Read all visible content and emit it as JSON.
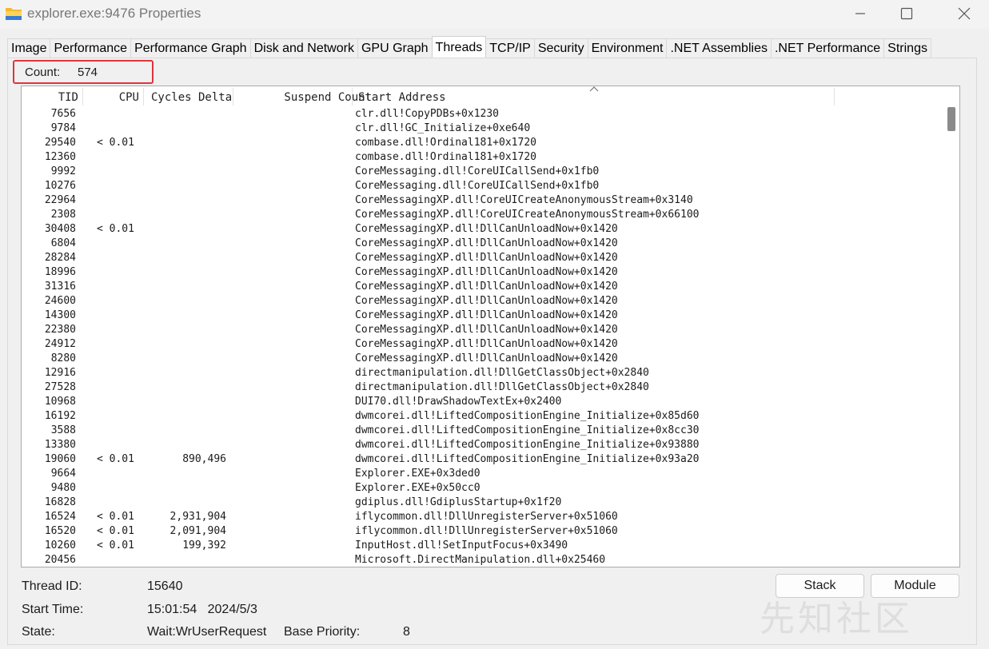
{
  "window": {
    "title": "explorer.exe:9476 Properties",
    "controls": {
      "minimize": "minimize-icon",
      "maximize": "maximize-icon",
      "close": "close-icon"
    }
  },
  "tabs": [
    {
      "label": "Image",
      "active": false
    },
    {
      "label": "Performance",
      "active": false
    },
    {
      "label": "Performance Graph",
      "active": false
    },
    {
      "label": "Disk and Network",
      "active": false
    },
    {
      "label": "GPU Graph",
      "active": false
    },
    {
      "label": "Threads",
      "active": true
    },
    {
      "label": "TCP/IP",
      "active": false
    },
    {
      "label": "Security",
      "active": false
    },
    {
      "label": "Environment",
      "active": false
    },
    {
      "label": ".NET Assemblies",
      "active": false
    },
    {
      "label": ".NET Performance",
      "active": false
    },
    {
      "label": "Strings",
      "active": false
    }
  ],
  "count": {
    "label": "Count:",
    "value": "574"
  },
  "columns": {
    "tid": "TID",
    "cpu": "CPU",
    "cycles": "Cycles Delta",
    "suspend": "Suspend Count",
    "address": "Start Address",
    "sorted_by": "Start Address",
    "sort_direction": "ascending"
  },
  "threads": [
    {
      "tid": "7656",
      "cpu": "",
      "cycles": "",
      "suspend": "",
      "address": "clr.dll!CopyPDBs+0x1230"
    },
    {
      "tid": "9784",
      "cpu": "",
      "cycles": "",
      "suspend": "",
      "address": "clr.dll!GC_Initialize+0xe640"
    },
    {
      "tid": "29540",
      "cpu": "< 0.01",
      "cycles": "",
      "suspend": "",
      "address": "combase.dll!Ordinal181+0x1720"
    },
    {
      "tid": "12360",
      "cpu": "",
      "cycles": "",
      "suspend": "",
      "address": "combase.dll!Ordinal181+0x1720"
    },
    {
      "tid": "9992",
      "cpu": "",
      "cycles": "",
      "suspend": "",
      "address": "CoreMessaging.dll!CoreUICallSend+0x1fb0"
    },
    {
      "tid": "10276",
      "cpu": "",
      "cycles": "",
      "suspend": "",
      "address": "CoreMessaging.dll!CoreUICallSend+0x1fb0"
    },
    {
      "tid": "22964",
      "cpu": "",
      "cycles": "",
      "suspend": "",
      "address": "CoreMessagingXP.dll!CoreUICreateAnonymousStream+0x3140"
    },
    {
      "tid": "2308",
      "cpu": "",
      "cycles": "",
      "suspend": "",
      "address": "CoreMessagingXP.dll!CoreUICreateAnonymousStream+0x66100"
    },
    {
      "tid": "30408",
      "cpu": "< 0.01",
      "cycles": "",
      "suspend": "",
      "address": "CoreMessagingXP.dll!DllCanUnloadNow+0x1420"
    },
    {
      "tid": "6804",
      "cpu": "",
      "cycles": "",
      "suspend": "",
      "address": "CoreMessagingXP.dll!DllCanUnloadNow+0x1420"
    },
    {
      "tid": "28284",
      "cpu": "",
      "cycles": "",
      "suspend": "",
      "address": "CoreMessagingXP.dll!DllCanUnloadNow+0x1420"
    },
    {
      "tid": "18996",
      "cpu": "",
      "cycles": "",
      "suspend": "",
      "address": "CoreMessagingXP.dll!DllCanUnloadNow+0x1420"
    },
    {
      "tid": "31316",
      "cpu": "",
      "cycles": "",
      "suspend": "",
      "address": "CoreMessagingXP.dll!DllCanUnloadNow+0x1420"
    },
    {
      "tid": "24600",
      "cpu": "",
      "cycles": "",
      "suspend": "",
      "address": "CoreMessagingXP.dll!DllCanUnloadNow+0x1420"
    },
    {
      "tid": "14300",
      "cpu": "",
      "cycles": "",
      "suspend": "",
      "address": "CoreMessagingXP.dll!DllCanUnloadNow+0x1420"
    },
    {
      "tid": "22380",
      "cpu": "",
      "cycles": "",
      "suspend": "",
      "address": "CoreMessagingXP.dll!DllCanUnloadNow+0x1420"
    },
    {
      "tid": "24912",
      "cpu": "",
      "cycles": "",
      "suspend": "",
      "address": "CoreMessagingXP.dll!DllCanUnloadNow+0x1420"
    },
    {
      "tid": "8280",
      "cpu": "",
      "cycles": "",
      "suspend": "",
      "address": "CoreMessagingXP.dll!DllCanUnloadNow+0x1420"
    },
    {
      "tid": "12916",
      "cpu": "",
      "cycles": "",
      "suspend": "",
      "address": "directmanipulation.dll!DllGetClassObject+0x2840"
    },
    {
      "tid": "27528",
      "cpu": "",
      "cycles": "",
      "suspend": "",
      "address": "directmanipulation.dll!DllGetClassObject+0x2840"
    },
    {
      "tid": "10968",
      "cpu": "",
      "cycles": "",
      "suspend": "",
      "address": "DUI70.dll!DrawShadowTextEx+0x2400"
    },
    {
      "tid": "16192",
      "cpu": "",
      "cycles": "",
      "suspend": "",
      "address": "dwmcorei.dll!LiftedCompositionEngine_Initialize+0x85d60"
    },
    {
      "tid": "3588",
      "cpu": "",
      "cycles": "",
      "suspend": "",
      "address": "dwmcorei.dll!LiftedCompositionEngine_Initialize+0x8cc30"
    },
    {
      "tid": "13380",
      "cpu": "",
      "cycles": "",
      "suspend": "",
      "address": "dwmcorei.dll!LiftedCompositionEngine_Initialize+0x93880"
    },
    {
      "tid": "19060",
      "cpu": "< 0.01",
      "cycles": "890,496",
      "suspend": "",
      "address": "dwmcorei.dll!LiftedCompositionEngine_Initialize+0x93a20"
    },
    {
      "tid": "9664",
      "cpu": "",
      "cycles": "",
      "suspend": "",
      "address": "Explorer.EXE+0x3ded0"
    },
    {
      "tid": "9480",
      "cpu": "",
      "cycles": "",
      "suspend": "",
      "address": "Explorer.EXE+0x50cc0"
    },
    {
      "tid": "16828",
      "cpu": "",
      "cycles": "",
      "suspend": "",
      "address": "gdiplus.dll!GdiplusStartup+0x1f20"
    },
    {
      "tid": "16524",
      "cpu": "< 0.01",
      "cycles": "2,931,904",
      "suspend": "",
      "address": "iflycommon.dll!DllUnregisterServer+0x51060"
    },
    {
      "tid": "16520",
      "cpu": "< 0.01",
      "cycles": "2,091,904",
      "suspend": "",
      "address": "iflycommon.dll!DllUnregisterServer+0x51060"
    },
    {
      "tid": "10260",
      "cpu": "< 0.01",
      "cycles": "199,392",
      "suspend": "",
      "address": "InputHost.dll!SetInputFocus+0x3490"
    },
    {
      "tid": "20456",
      "cpu": "",
      "cycles": "",
      "suspend": "",
      "address": "Microsoft.DirectManipulation.dll+0x25460"
    }
  ],
  "details": {
    "thread_id_label": "Thread ID:",
    "thread_id": "15640",
    "start_time_label": "Start Time:",
    "start_time": "15:01:54   2024/5/3",
    "state_label": "State:",
    "state": "Wait:WrUserRequest",
    "base_priority_label": "Base Priority:",
    "base_priority": "8"
  },
  "buttons": {
    "stack": "Stack",
    "module": "Module"
  },
  "watermark": "先知社区",
  "colors": {
    "highlight_box": "#e0343a",
    "folder_icon": "#f5b82e"
  }
}
